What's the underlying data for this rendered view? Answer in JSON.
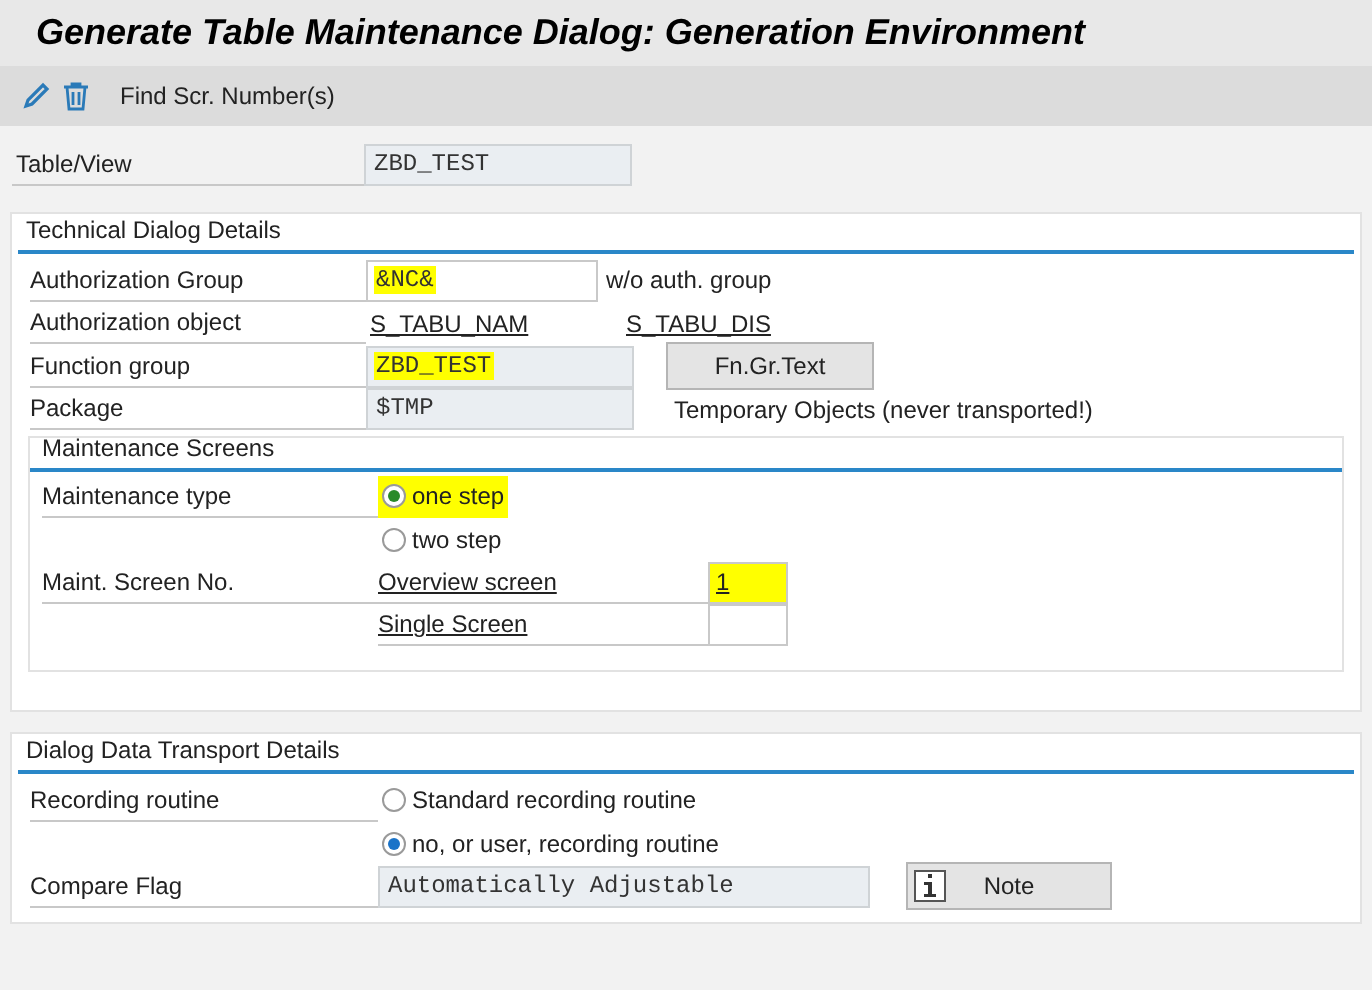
{
  "title": "Generate Table Maintenance Dialog: Generation Environment",
  "toolbar": {
    "icons": [
      {
        "kind": "pencil"
      },
      {
        "kind": "trash"
      }
    ],
    "button": "Find Scr. Number(s)"
  },
  "table_view": {
    "label": "Table/View",
    "value": "ZBD_TEST"
  },
  "technical": {
    "title": "Technical Dialog Details",
    "auth_group": {
      "label": "Authorization Group",
      "value": "&NC&",
      "highlighted": true,
      "note": "w/o auth. group"
    },
    "auth_object": {
      "label": "Authorization object",
      "links": [
        "S_TABU_NAM",
        "S_TABU_DIS"
      ]
    },
    "function_group": {
      "label": "Function group",
      "value": "ZBD_TEST",
      "highlighted": true,
      "button": "Fn.Gr.Text"
    },
    "package": {
      "label": "Package",
      "value": "$TMP",
      "note": "Temporary Objects (never transported!)"
    },
    "maintenance": {
      "title": "Maintenance Screens",
      "type_label": "Maintenance type",
      "types": [
        {
          "label": "one step",
          "selected": true,
          "highlighted": true
        },
        {
          "label": "two step",
          "selected": false,
          "highlighted": false
        }
      ],
      "screen_label": "Maint. Screen No.",
      "screens": [
        {
          "label": "Overview screen",
          "value": "1",
          "highlighted": true
        },
        {
          "label": "Single Screen",
          "highlighted": false
        }
      ]
    }
  },
  "transport": {
    "title": "Dialog Data Transport Details",
    "recording_label": "Recording routine",
    "recording": [
      {
        "label": "Standard recording routine",
        "selected": false
      },
      {
        "label": "no, or user, recording routine",
        "selected": true
      }
    ],
    "compare": {
      "label": "Compare Flag",
      "value": "Automatically Adjustable",
      "button": "Note"
    }
  }
}
